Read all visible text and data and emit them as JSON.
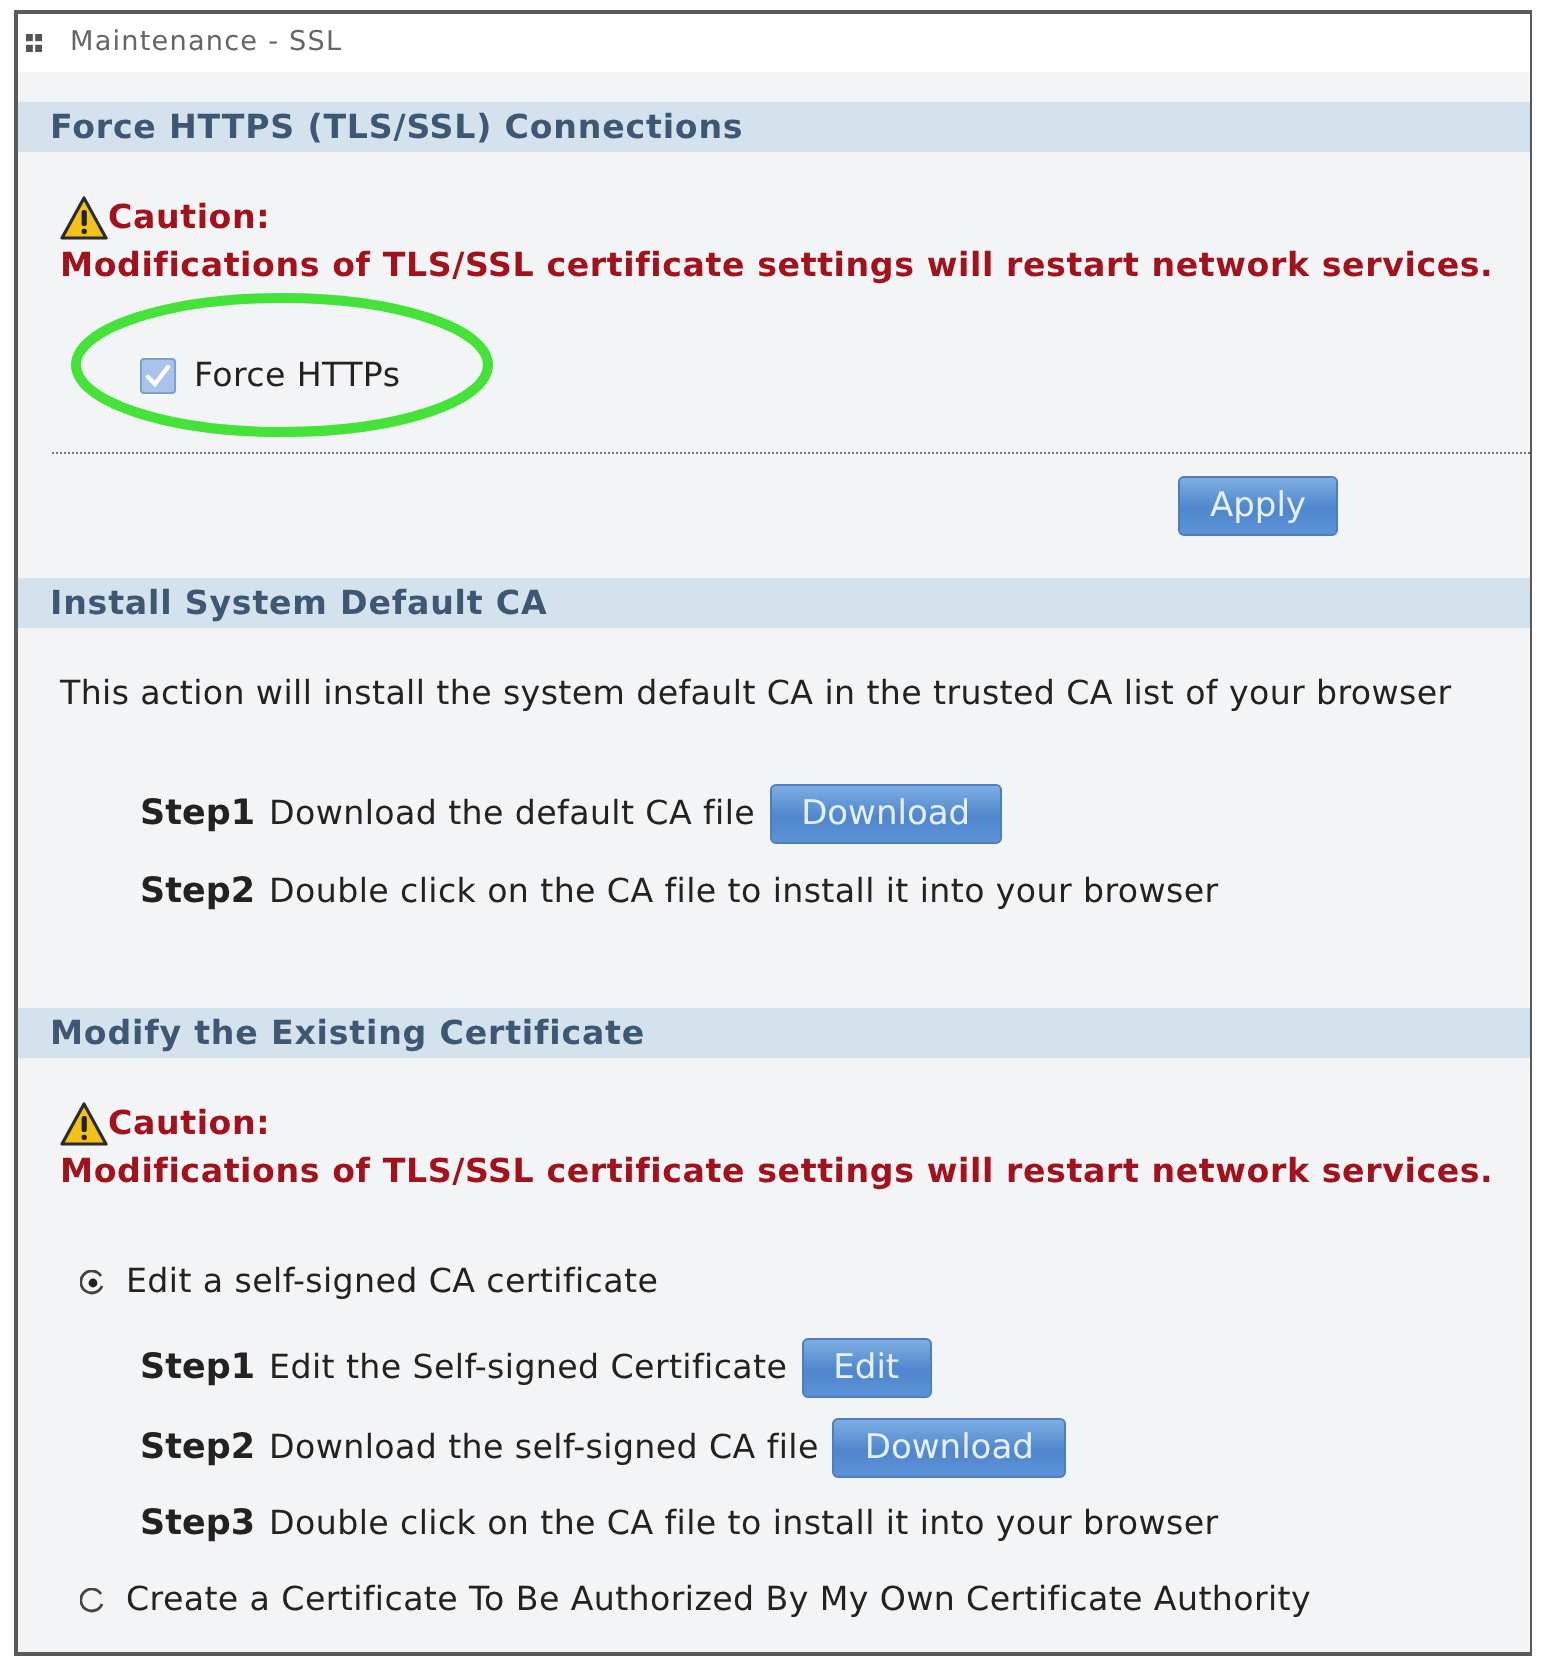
{
  "window": {
    "title": "Maintenance - SSL"
  },
  "sections": [
    {
      "title": "Force HTTPS (TLS/SSL) Connections",
      "items": [
        {
          "kind": "caution",
          "label": "Caution:",
          "message": "Modifications of TLS/SSL certificate settings will restart network services."
        },
        {
          "kind": "checkbox",
          "label": "Force HTTPs",
          "checked": true,
          "highlighted": true
        }
      ],
      "buttons": [
        "Apply"
      ]
    },
    {
      "title": "Install System Default CA",
      "items": [
        {
          "kind": "paragraph",
          "text": "This action will install the system default CA in the trusted CA list of your browser"
        },
        {
          "kind": "step",
          "step": "Step1",
          "text": "Download the default CA file",
          "button": "Download"
        },
        {
          "kind": "step",
          "step": "Step2",
          "text": "Double click on the CA file to install it into your browser"
        }
      ]
    },
    {
      "title": "Modify the Existing Certificate",
      "items": [
        {
          "kind": "caution",
          "label": "Caution:",
          "message": "Modifications of TLS/SSL certificate settings will restart network services."
        },
        {
          "kind": "radio",
          "label": "Edit a self-signed CA certificate",
          "selected": true,
          "children": [
            {
              "kind": "step",
              "step": "Step1",
              "text": "Edit the Self-signed Certificate",
              "button": "Edit"
            },
            {
              "kind": "step",
              "step": "Step2",
              "text": "Download the self-signed CA file",
              "button": "Download"
            },
            {
              "kind": "step",
              "step": "Step3",
              "text": "Double click on the CA file to install it into your browser"
            }
          ]
        },
        {
          "kind": "radio",
          "label": "Create a Certificate To Be Authorized By My Own Certificate Authority",
          "selected": false
        }
      ]
    }
  ]
}
